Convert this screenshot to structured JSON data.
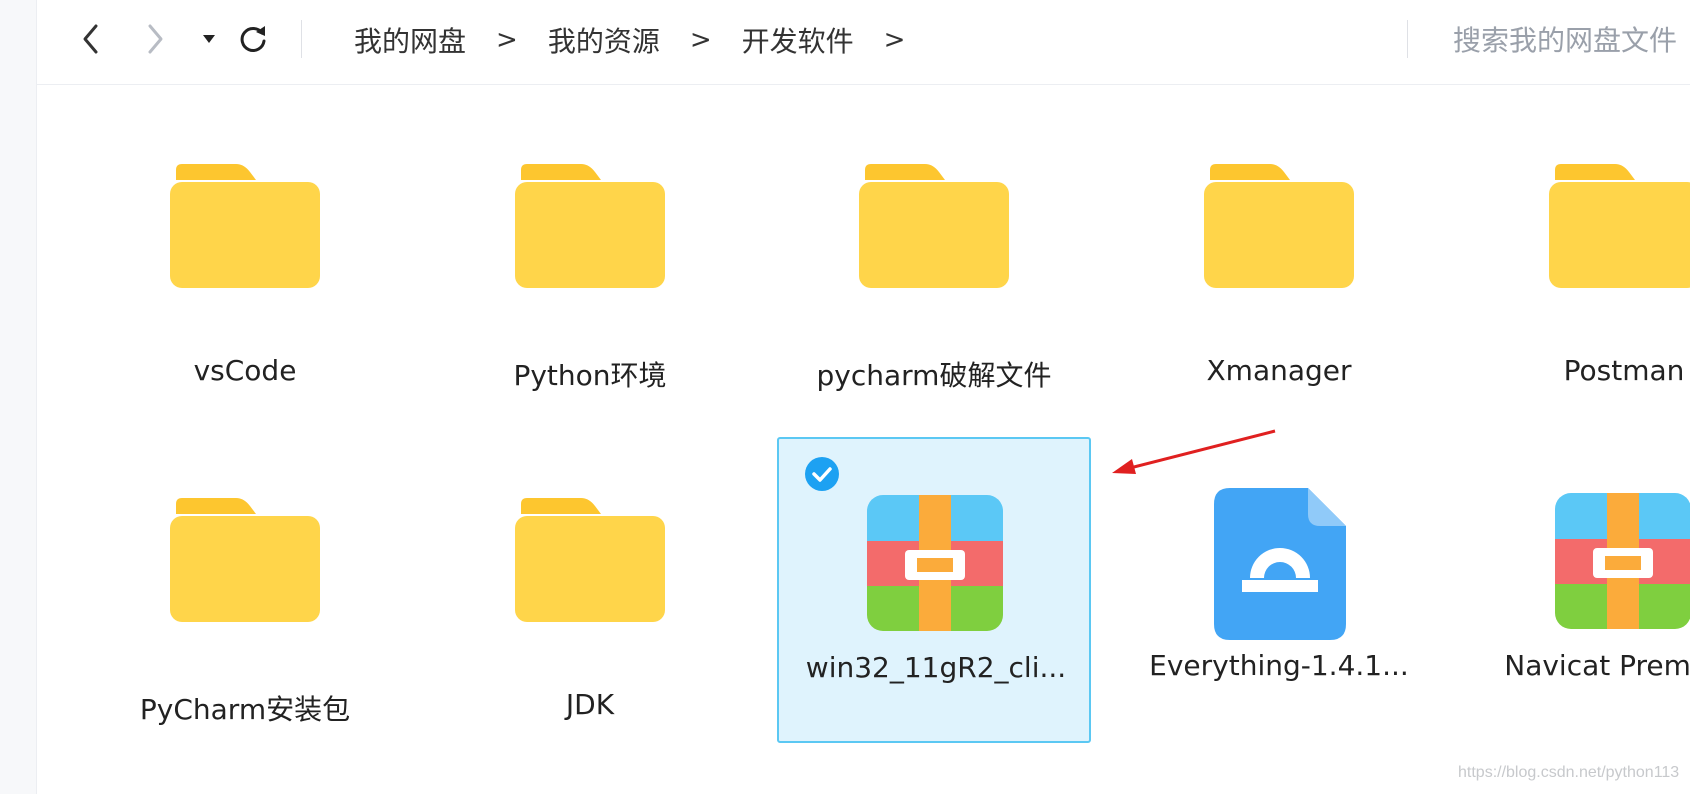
{
  "toolbar": {
    "back_icon": "chevron-left-icon",
    "forward_icon": "chevron-right-icon",
    "history_icon": "caret-down-icon",
    "refresh_icon": "refresh-icon"
  },
  "breadcrumb": {
    "items": [
      "我的网盘",
      "我的资源",
      "开发软件"
    ],
    "separator": ">"
  },
  "search": {
    "placeholder": "搜索我的网盘文件"
  },
  "files": [
    {
      "name": "vsCode",
      "type": "folder"
    },
    {
      "name": "Python环境",
      "type": "folder"
    },
    {
      "name": "pycharm破解文件",
      "type": "folder"
    },
    {
      "name": "Xmanager",
      "type": "folder"
    },
    {
      "name": "Postman",
      "type": "folder"
    },
    {
      "name": "PyCharm安装包",
      "type": "folder"
    },
    {
      "name": "JDK",
      "type": "folder"
    },
    {
      "name": "win32_11gR2_cli...",
      "type": "archive",
      "selected": true
    },
    {
      "name": "Everything-1.4.1...",
      "type": "app"
    },
    {
      "name": "Navicat Premium",
      "type": "archive"
    }
  ],
  "watermark": "https://blog.csdn.net/python113",
  "colors": {
    "folder": "#ffd54a",
    "folder_tab": "#fdc62f",
    "selection_bg": "#dff3fd",
    "selection_border": "#5bc8f3",
    "check": "#1da1f2",
    "arrow": "#e02020"
  }
}
